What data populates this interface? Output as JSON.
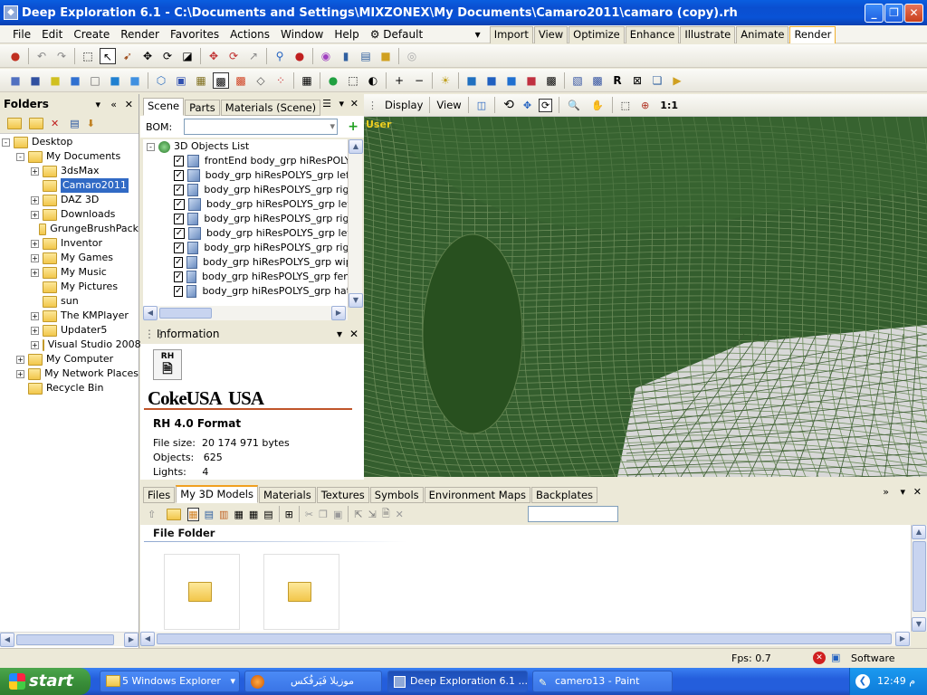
{
  "window": {
    "title": "Deep Exploration 6.1 - C:\\Documents and Settings\\MIXZONEX\\My Documents\\Camaro2011\\camaro (copy).rh"
  },
  "menu": {
    "items": [
      "File",
      "Edit",
      "Create",
      "Render",
      "Favorites",
      "Actions",
      "Window",
      "Help"
    ],
    "preset": "Default",
    "modes": [
      "Import",
      "View",
      "Optimize",
      "Enhance",
      "Illustrate",
      "Animate",
      "Render"
    ],
    "active_mode": "Render"
  },
  "folders": {
    "title": "Folders",
    "tree": [
      {
        "label": "Desktop",
        "level": 0,
        "exp": "-"
      },
      {
        "label": "My Documents",
        "level": 1,
        "exp": "-"
      },
      {
        "label": "3dsMax",
        "level": 2,
        "exp": "+"
      },
      {
        "label": "Camaro2011",
        "level": 2,
        "exp": "",
        "selected": true
      },
      {
        "label": "DAZ 3D",
        "level": 2,
        "exp": "+"
      },
      {
        "label": "Downloads",
        "level": 2,
        "exp": "+"
      },
      {
        "label": "GrungeBrushPack",
        "level": 2,
        "exp": ""
      },
      {
        "label": "Inventor",
        "level": 2,
        "exp": "+"
      },
      {
        "label": "My Games",
        "level": 2,
        "exp": "+"
      },
      {
        "label": "My Music",
        "level": 2,
        "exp": "+"
      },
      {
        "label": "My Pictures",
        "level": 2,
        "exp": ""
      },
      {
        "label": "sun",
        "level": 2,
        "exp": ""
      },
      {
        "label": "The KMPlayer",
        "level": 2,
        "exp": "+"
      },
      {
        "label": "Updater5",
        "level": 2,
        "exp": "+"
      },
      {
        "label": "Visual Studio 2008",
        "level": 2,
        "exp": "+"
      },
      {
        "label": "My Computer",
        "level": 1,
        "exp": "+"
      },
      {
        "label": "My Network Places",
        "level": 1,
        "exp": "+"
      },
      {
        "label": "Recycle Bin",
        "level": 1,
        "exp": ""
      }
    ]
  },
  "scene": {
    "tabs": [
      "Scene",
      "Parts",
      "Materials (Scene)"
    ],
    "bom_label": "BOM:",
    "root": "3D Objects List",
    "objects": [
      "frontEnd body_grp hiResPOLYS_",
      "body_grp hiResPOLYS_grp leftFr",
      "body_grp hiResPOLYS_grp rightI",
      "body_grp hiResPOLYS_grp leftD",
      "body_grp hiResPOLYS_grp rightI",
      "body_grp hiResPOLYS_grp leftR",
      "body_grp hiResPOLYS_grp rightI",
      "body_grp hiResPOLYS_grp wiper",
      "body_grp hiResPOLYS_grp fende",
      "body_grp hiResPOLYS_grp hatch"
    ]
  },
  "info": {
    "title": "Information",
    "icon_label": "RH",
    "logo": "CokeUSA  USA",
    "format": "RH 4.0 Format",
    "file_size_label": "File size:",
    "file_size": "20 174 971 bytes",
    "objects_label": "Objects:",
    "objects": "625",
    "lights_label": "Lights:",
    "lights": "4"
  },
  "viewport": {
    "toolbar": {
      "display": "Display",
      "view": "View",
      "ratio": "1:1"
    },
    "label": "User",
    "colors": {
      "background": "#345e2e",
      "wire": "#6c8c5a",
      "floor": "#d8d8d8"
    }
  },
  "bottom": {
    "tabs": [
      "Files",
      "My 3D Models",
      "Materials",
      "Textures",
      "Symbols",
      "Environment Maps",
      "Backplates"
    ],
    "active_tab": "My 3D Models",
    "section": "File Folder"
  },
  "status": {
    "fps_label": "Fps:",
    "fps": "0.7",
    "renderer": "Software"
  },
  "taskbar": {
    "start": "start",
    "tasks": [
      "5 Windows Explorer",
      "موزيلا فَيَرفُكس",
      "Deep Exploration 6.1 ...",
      "camero13 - Paint"
    ],
    "clock": "12:49 م"
  }
}
